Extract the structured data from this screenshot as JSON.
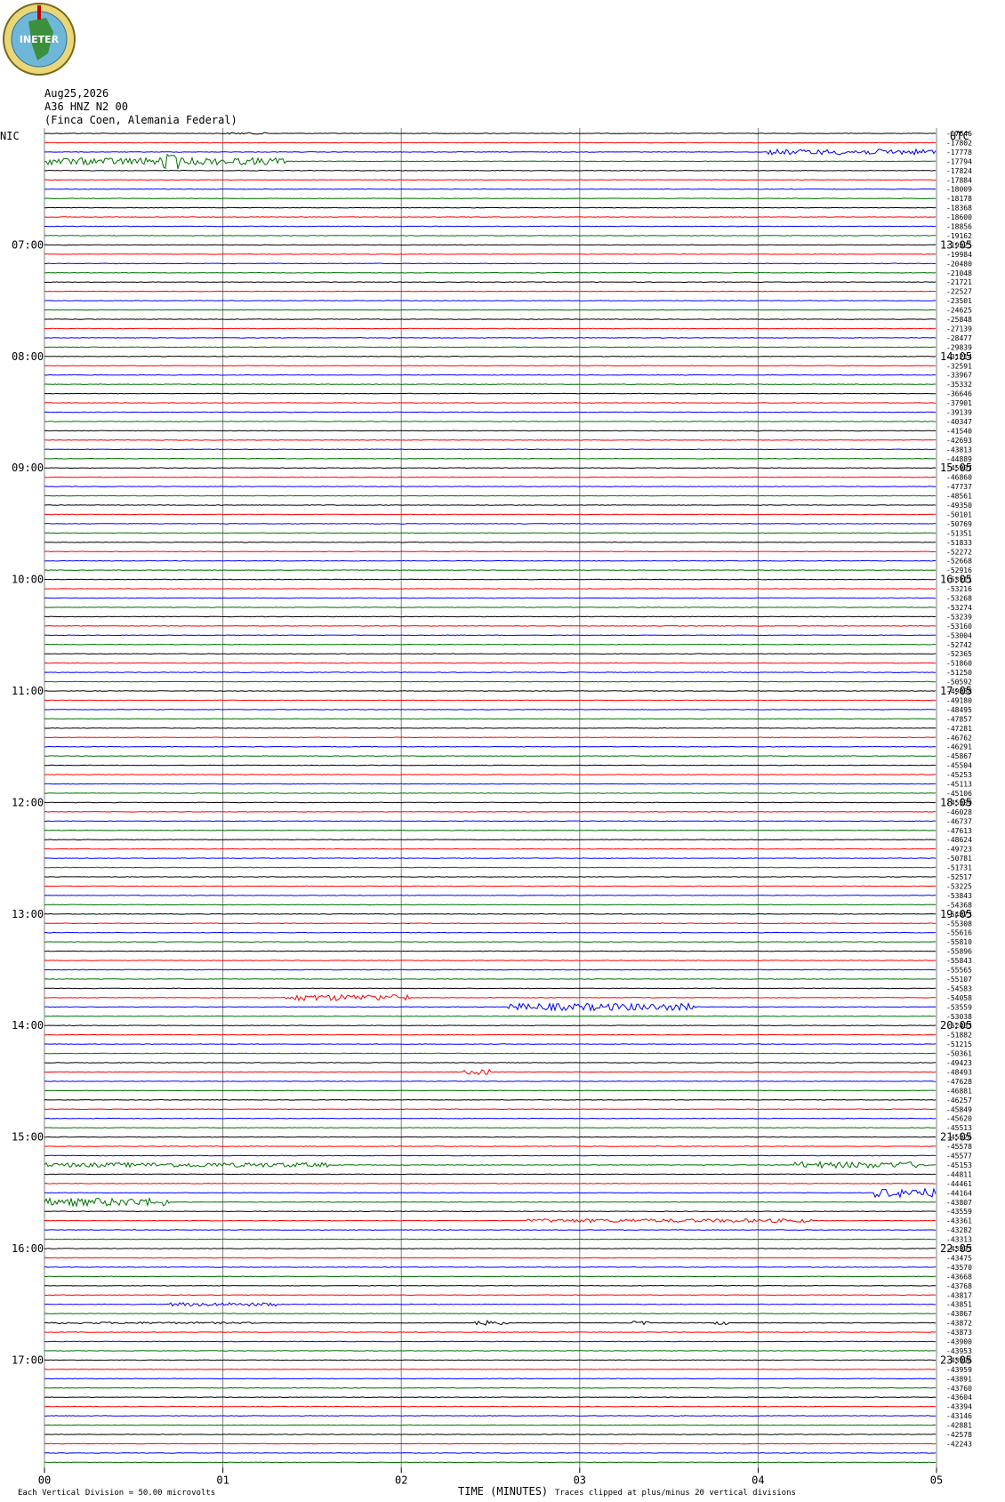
{
  "header": {
    "logo_text": "INETER",
    "date": "Aug25,2026",
    "station": "A36 HNZ N2 00",
    "location": "(Finca Coen, Alemania Federal)",
    "left_tz": "NIC",
    "right_tz": "UTC"
  },
  "footer": {
    "scale_note": "Each Vertical Division =   50.00 microvolts",
    "xlabel": "TIME (MINUTES)",
    "clip_note": "Traces clipped at plus/minus 20 vertical divisions"
  },
  "colors": [
    "#000000",
    "#ff0000",
    "#0000ff",
    "#007000"
  ],
  "chart_data": {
    "type": "line",
    "title": "",
    "xlabel": "TIME (MINUTES)",
    "x_ticks": [
      "00",
      "01",
      "02",
      "03",
      "04",
      "05"
    ],
    "xlim": [
      0,
      5
    ],
    "trace_count": 144,
    "trace_color_cycle": [
      "black",
      "red",
      "blue",
      "green"
    ],
    "left_hour_labels": [
      "07:00",
      "08:00",
      "09:00",
      "10:00",
      "11:00",
      "12:00",
      "13:00",
      "14:00",
      "15:00",
      "16:00",
      "17:00"
    ],
    "right_hour_labels": [
      "13:05",
      "14:05",
      "15:05",
      "16:05",
      "17:05",
      "18:05",
      "19:05",
      "20:05",
      "21:05",
      "22:05",
      "23:05"
    ],
    "hour_label_first_trace": 12,
    "hour_label_every": 12,
    "offsets": [
      "-17646",
      "-17802",
      "-17778",
      "-17794",
      "-17824",
      "-17884",
      "-18009",
      "-18178",
      "-18368",
      "-18600",
      "-18856",
      "-19162",
      "-19525",
      "-19984",
      "-20480",
      "-21048",
      "-21721",
      "-22527",
      "-23501",
      "-24625",
      "-25848",
      "-27139",
      "-28477",
      "-29839",
      "-31214",
      "-32591",
      "-33967",
      "-35332",
      "-36646",
      "-37901",
      "-39139",
      "-40347",
      "-41540",
      "-42693",
      "-43813",
      "-44889",
      "-45907",
      "-46860",
      "-47737",
      "-48561",
      "-49350",
      "-50101",
      "-50769",
      "-51351",
      "-51833",
      "-52272",
      "-52668",
      "-52916",
      "-53111",
      "-53216",
      "-53268",
      "-53274",
      "-53239",
      "-53160",
      "-53004",
      "-52742",
      "-52365",
      "-51860",
      "-51250",
      "-50592",
      "-49888",
      "-49180",
      "-48495",
      "-47857",
      "-47281",
      "-46762",
      "-46291",
      "-45867",
      "-45504",
      "-45253",
      "-45113",
      "-45106",
      "-45509",
      "-46028",
      "-46737",
      "-47613",
      "-48624",
      "-49723",
      "-50781",
      "-51731",
      "-52517",
      "-53225",
      "-53843",
      "-54368",
      "-54873",
      "-55308",
      "-55616",
      "-55810",
      "-55896",
      "-55843",
      "-55565",
      "-55107",
      "-54583",
      "-54058",
      "-53559",
      "-53038",
      "-52483",
      "-51882",
      "-51215",
      "-50361",
      "-49423",
      "-48493",
      "-47628",
      "-46881",
      "-46257",
      "-45849",
      "-45620",
      "-45513",
      "-45526",
      "-45578",
      "-45577",
      "-45153",
      "-44811",
      "-44461",
      "-44164",
      "-43807",
      "-43559",
      "-43361",
      "-43282",
      "-43313",
      "-43393",
      "-43475",
      "-43570",
      "-43668",
      "-43768",
      "-43817",
      "-43851",
      "-43867",
      "-43872",
      "-43873",
      "-43900",
      "-43953",
      "-43996",
      "-43959",
      "-43891",
      "-43760",
      "-43604",
      "-43394",
      "-43146",
      "-42881",
      "-42578",
      "-42243"
    ],
    "events": [
      {
        "trace": 0,
        "start_min": 1.0,
        "end_min": 1.25,
        "amplitude_div": 2
      },
      {
        "trace": 2,
        "start_min": 4.05,
        "end_min": 5.0,
        "amplitude_div": 6
      },
      {
        "trace": 3,
        "start_min": 0.0,
        "end_min": 1.35,
        "amplitude_div": 8
      },
      {
        "trace": 3,
        "start_min": 0.65,
        "end_min": 0.75,
        "amplitude_div": 18
      },
      {
        "trace": 93,
        "start_min": 1.35,
        "end_min": 2.05,
        "amplitude_div": 7
      },
      {
        "trace": 94,
        "start_min": 2.6,
        "end_min": 3.65,
        "amplitude_div": 8
      },
      {
        "trace": 101,
        "start_min": 2.35,
        "end_min": 2.5,
        "amplitude_div": 6
      },
      {
        "trace": 111,
        "start_min": 0.0,
        "end_min": 1.6,
        "amplitude_div": 5
      },
      {
        "trace": 111,
        "start_min": 4.2,
        "end_min": 4.95,
        "amplitude_div": 7
      },
      {
        "trace": 114,
        "start_min": 4.65,
        "end_min": 5.0,
        "amplitude_div": 10
      },
      {
        "trace": 115,
        "start_min": 0.0,
        "end_min": 0.7,
        "amplitude_div": 9
      },
      {
        "trace": 117,
        "start_min": 2.7,
        "end_min": 4.3,
        "amplitude_div": 4
      },
      {
        "trace": 126,
        "start_min": 0.7,
        "end_min": 1.3,
        "amplitude_div": 4
      },
      {
        "trace": 128,
        "start_min": 0.0,
        "end_min": 1.2,
        "amplitude_div": 2
      },
      {
        "trace": 128,
        "start_min": 2.4,
        "end_min": 2.6,
        "amplitude_div": 5
      },
      {
        "trace": 128,
        "start_min": 3.3,
        "end_min": 3.4,
        "amplitude_div": 4
      },
      {
        "trace": 128,
        "start_min": 3.75,
        "end_min": 3.85,
        "amplitude_div": 4
      }
    ]
  }
}
